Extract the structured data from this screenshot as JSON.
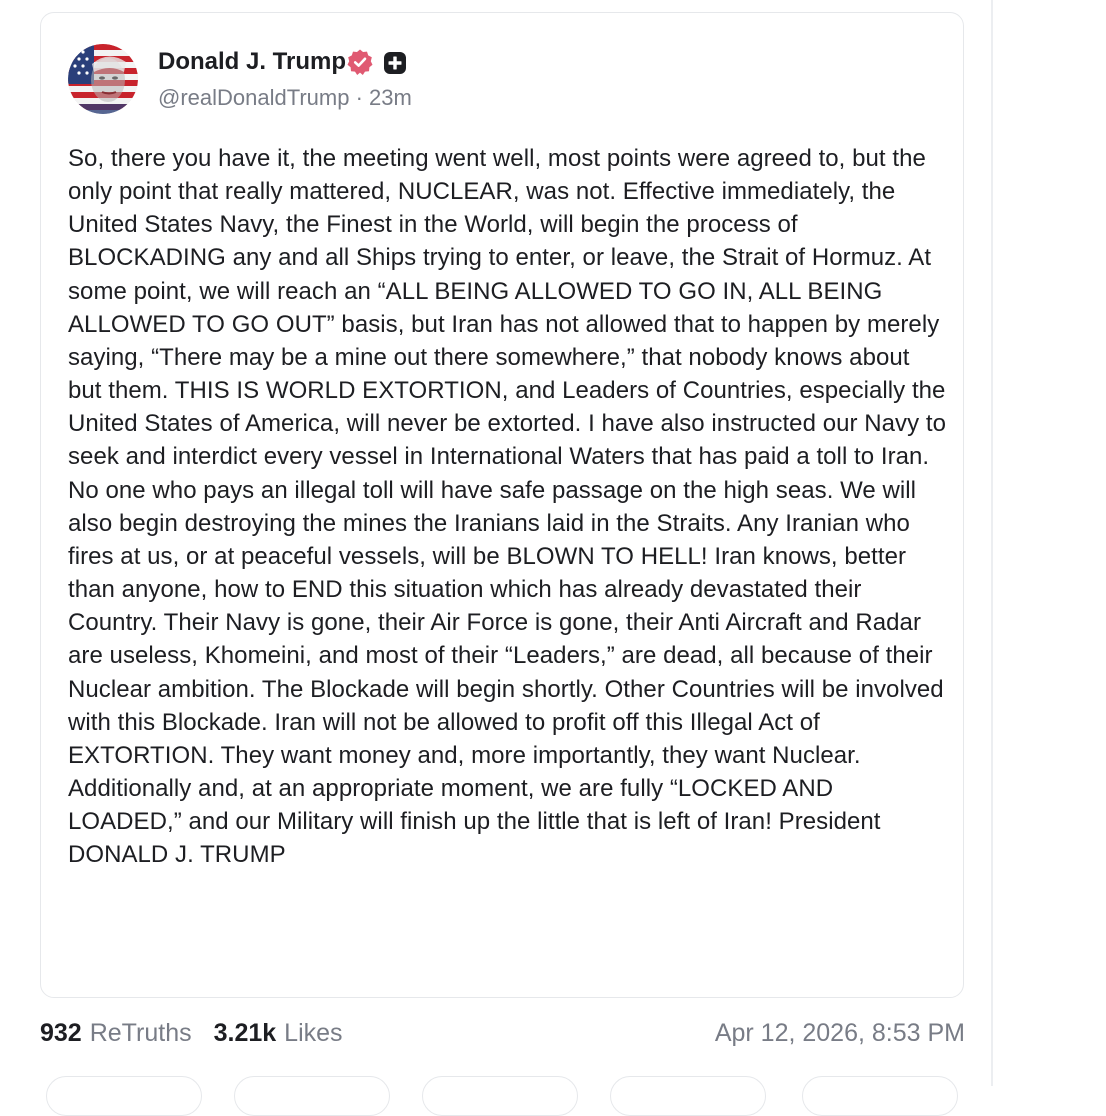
{
  "post": {
    "author": {
      "name": "Donald J. Trump",
      "handle": "@realDonaldTrump",
      "time_ago": "23m",
      "handle_line": "@realDonaldTrump · 23m"
    },
    "body": "So, there you have it, the meeting went well, most points were agreed to, but the only point that really mattered, NUCLEAR, was not. Effective immediately, the United States Navy, the Finest in the World, will begin the process of BLOCKADING any and all Ships trying to enter, or leave, the Strait of Hormuz. At some point, we will reach an “ALL BEING ALLOWED TO GO IN, ALL BEING ALLOWED TO GO OUT” basis, but Iran has not allowed that to happen by merely saying, “There may be a mine out there somewhere,” that nobody knows about but them. THIS IS WORLD EXTORTION, and Leaders of Countries, especially the United States of America, will never be extorted. I have also instructed our Navy to seek and interdict every vessel in International Waters that has paid a toll to Iran. No one who pays an illegal toll will have safe passage on the high seas. We will also begin destroying the mines the Iranians laid in the Straits. Any Iranian who fires at us, or at peaceful vessels, will be BLOWN TO HELL! Iran knows, better than anyone, how to END this situation which has already devastated their Country. Their Navy is gone, their Air Force is gone, their Anti Aircraft and Radar are useless, Khomeini, and most of their “Leaders,” are dead, all because of their Nuclear ambition. The Blockade will begin shortly. Other Countries will be involved with this Blockade. Iran will not be allowed to profit off this Illegal Act of EXTORTION. They want money and, more importantly, they want Nuclear. Additionally and, at an appropriate moment, we are fully “LOCKED AND LOADED,” and our Military will finish up the little that is left of Iran! President DONALD J. TRUMP"
  },
  "stats": {
    "retruths_count": "932",
    "retruths_label": "ReTruths",
    "likes_count": "3.21k",
    "likes_label": "Likes",
    "timestamp": "Apr 12, 2026, 8:53 PM"
  },
  "icons": {
    "verified": "verified-badge-icon",
    "plus": "plus-icon"
  },
  "colors": {
    "verified_badge": "#e05a72",
    "text_primary": "#1d1e22",
    "text_secondary": "#787c86",
    "border": "#e6e8eb"
  }
}
